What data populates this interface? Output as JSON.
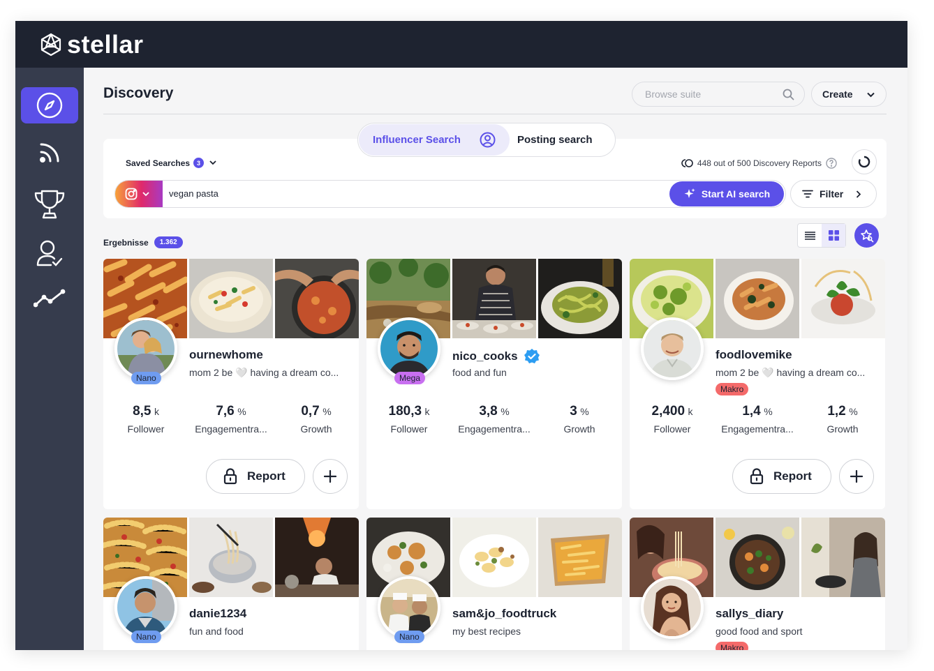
{
  "app": {
    "name": "stellar"
  },
  "page": {
    "title": "Discovery"
  },
  "header": {
    "browse_placeholder": "Browse suite",
    "create_label": "Create"
  },
  "tabs": {
    "influencer": "Influencer Search",
    "posting": "Posting search"
  },
  "search": {
    "saved_label": "Saved Searches",
    "saved_count": "3",
    "quota_text": "448 out of 500 Discovery Reports",
    "platform": "instagram",
    "query": "vegan pasta",
    "ai_button": "Start AI search",
    "filter_button": "Filter"
  },
  "results": {
    "label": "Ergebnisse",
    "count": "1.362"
  },
  "colors": {
    "accent": "#5b50e8",
    "topbar": "#1e2330",
    "sidebar": "#363c4d",
    "nano": "#6f9cf0",
    "mega": "#c86ff0",
    "makro": "#f46a6a"
  },
  "sidebar": [
    "compass-icon",
    "rss-icon",
    "trophy-icon",
    "user-check-icon",
    "trend-icon"
  ],
  "cards": [
    {
      "username": "ournewhome",
      "bio": "mom 2 be 🤍 having a dream co...",
      "tier": "Nano",
      "verified": false,
      "stats": [
        {
          "v": "8,5",
          "u": "k",
          "l": "Follower"
        },
        {
          "v": "7,6",
          "u": "%",
          "l": "Engagementra..."
        },
        {
          "v": "0,7",
          "u": "%",
          "l": "Growth"
        }
      ],
      "report": "Report"
    },
    {
      "username": "nico_cooks",
      "bio": "food and fun",
      "tier": "Mega",
      "verified": true,
      "stats": [
        {
          "v": "180,3",
          "u": "k",
          "l": "Follower"
        },
        {
          "v": "3,8",
          "u": "%",
          "l": "Engagementra..."
        },
        {
          "v": "3",
          "u": "%",
          "l": "Growth"
        }
      ],
      "report": ""
    },
    {
      "username": "foodlovemike",
      "bio": "mom 2 be 🤍 having a dream co...",
      "tier": "Makro",
      "verified": false,
      "stats": [
        {
          "v": "2,400",
          "u": "k",
          "l": "Follower"
        },
        {
          "v": "1,4",
          "u": "%",
          "l": "Engagementra..."
        },
        {
          "v": "1,2",
          "u": "%",
          "l": "Growth"
        }
      ],
      "report": "Report"
    },
    {
      "username": "danie1234",
      "bio": "fun and food",
      "tier": "Nano",
      "verified": false,
      "stats": [],
      "report": ""
    },
    {
      "username": "sam&jo_foodtruck",
      "bio": "my best recipes",
      "tier": "Nano",
      "verified": false,
      "stats": [],
      "report": ""
    },
    {
      "username": "sallys_diary",
      "bio": "good food and sport",
      "tier": "Makro",
      "verified": false,
      "stats": [],
      "report": ""
    }
  ]
}
